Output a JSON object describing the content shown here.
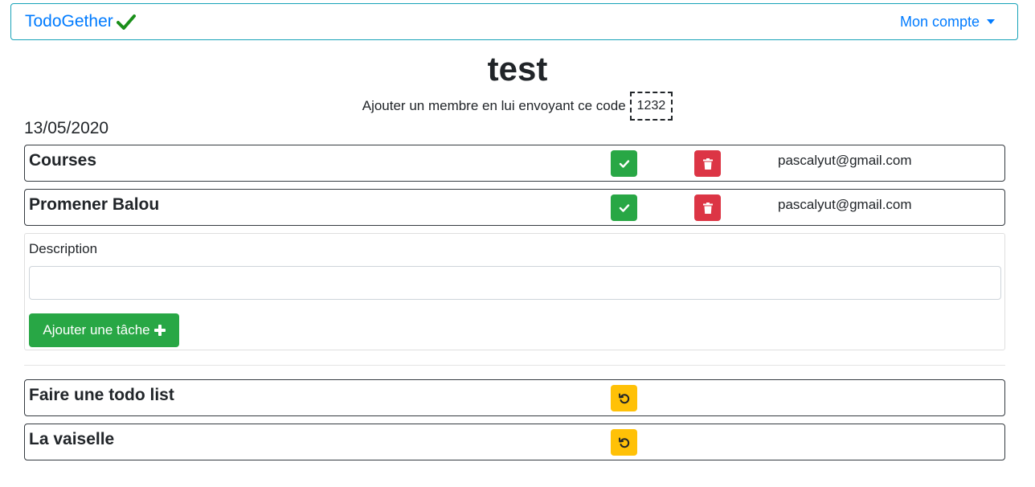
{
  "navbar": {
    "brand": "TodoGether",
    "account_label": "Mon compte"
  },
  "list": {
    "title": "test",
    "invite_text": "Ajouter un membre en lui envoyant ce code",
    "invite_code": "1232",
    "date": "13/05/2020"
  },
  "active_tasks": [
    {
      "label": "Courses",
      "user": "pascalyut@gmail.com"
    },
    {
      "label": "Promener Balou",
      "user": "pascalyut@gmail.com"
    }
  ],
  "form": {
    "description_label": "Description",
    "description_value": "",
    "add_button_label": "Ajouter une tâche"
  },
  "done_tasks": [
    {
      "label": "Faire une todo list"
    },
    {
      "label": "La vaiselle"
    }
  ],
  "colors": {
    "primary": "#007bff",
    "success": "#28a745",
    "danger": "#dc3545",
    "warning": "#ffc107",
    "navbar_border": "#17a2b8"
  }
}
